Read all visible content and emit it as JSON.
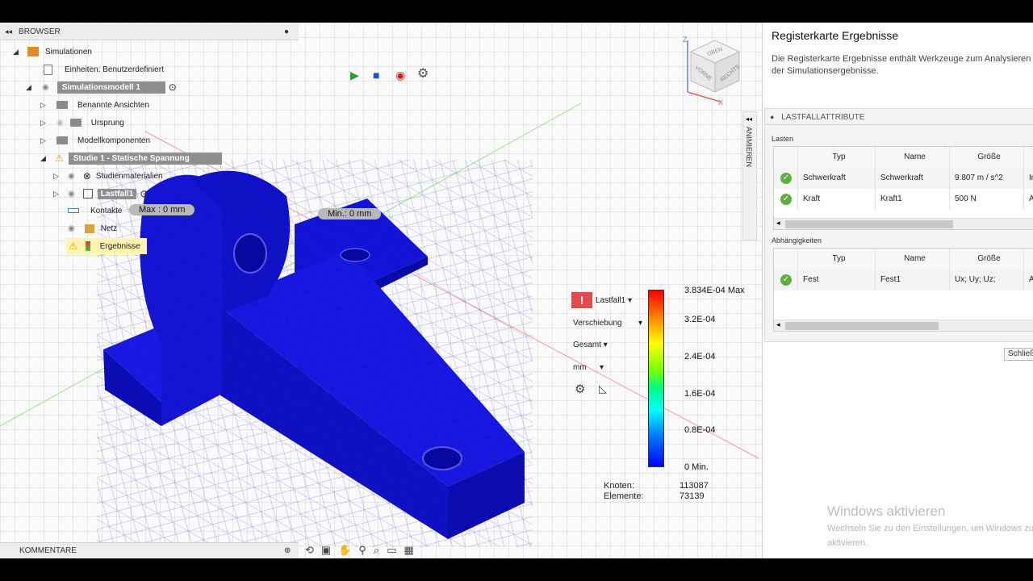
{
  "browser": {
    "title": "BROWSER",
    "tree": {
      "simulations": "Simulationen",
      "units": "Einheiten: Benutzerdefiniert",
      "model": "Simulationsmodell 1",
      "named_views": "Benannte Ansichten",
      "origin": "Ursprung",
      "model_components": "Modellkomponenten",
      "study": "Studie 1 - Statische Spannung",
      "study_materials": "Studienmaterialien",
      "load_case": "Lastfall1",
      "contacts": "Kontakte",
      "mesh": "Netz",
      "results": "Ergebnisse"
    }
  },
  "probes": {
    "max": "Max : 0 mm",
    "min": "Min.: 0 mm"
  },
  "results_panel": {
    "load_case": "Lastfall1",
    "result_type": "Verschiebung",
    "component": "Gesamt",
    "unit": "mm",
    "legend": [
      "3.834E-04 Max",
      "3.2E-04",
      "2.4E-04",
      "1.6E-04",
      "0.8E-04",
      "0 Min."
    ],
    "nodes_label": "Knoten:",
    "nodes_value": "113087",
    "elements_label": "Elemente:",
    "elements_value": "73139"
  },
  "viewcube": {
    "top": "OBEN",
    "front": "VORNE",
    "right": "RECHTS",
    "axis_z": "Z",
    "axis_x": "X"
  },
  "animate_tab": "ANIMIEREN",
  "comments": "KOMMENTARE",
  "help": {
    "title": "Registerkarte Ergebnisse",
    "desc": "Die Registerkarte Ergebnisse enthält Werkzeuge zum Analysieren der Simulationsergebnisse."
  },
  "load_attributes": {
    "title": "LASTFALLATTRIBUTE",
    "loads_label": "Lasten",
    "columns": [
      "Typ",
      "Name",
      "Größe"
    ],
    "loads": [
      {
        "type": "Schwerkraft",
        "name": "Schwerkraft",
        "size": "9.807 m / s^2",
        "extra": "Im"
      },
      {
        "type": "Kraft",
        "name": "Kraft1",
        "size": "500 N",
        "extra": "An"
      }
    ],
    "constraints_label": "Abhängigkeiten",
    "constraints": [
      {
        "type": "Fest",
        "name": "Fest1",
        "size": "Ux; Uy; Uz;",
        "extra": "An"
      }
    ],
    "close": "Schließ"
  },
  "watermark": {
    "title": "Windows aktivieren",
    "line1": "Wechseln Sie zu den Einstellungen, um Windows zu",
    "line2": "aktivieren."
  }
}
